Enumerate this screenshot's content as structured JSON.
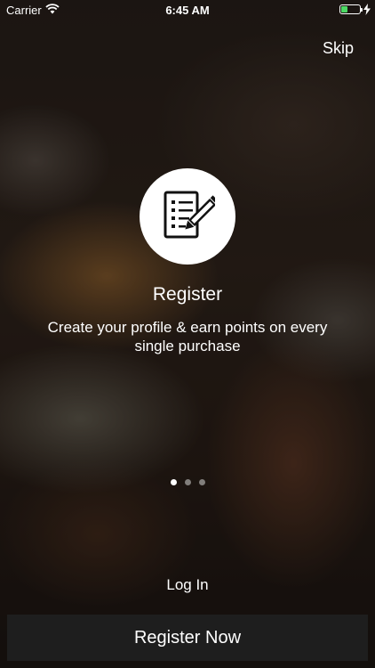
{
  "status_bar": {
    "carrier": "Carrier",
    "time": "6:45 AM",
    "battery_level": 0.35,
    "battery_color": "#4cd964"
  },
  "header": {
    "skip_label": "Skip"
  },
  "onboarding": {
    "icon": "register-document-pencil-icon",
    "title": "Register",
    "description": "Create your profile & earn points on every single purchase",
    "page_count": 3,
    "active_page": 1
  },
  "actions": {
    "login_label": "Log In",
    "register_label": "Register Now"
  },
  "colors": {
    "button_background": "#1e1e1e",
    "text": "#ffffff",
    "icon_circle": "#ffffff"
  }
}
